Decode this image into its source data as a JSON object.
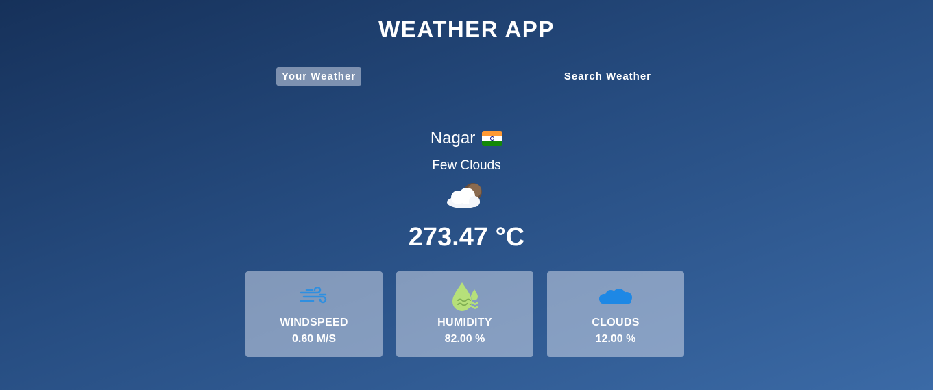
{
  "header": {
    "title": "WEATHER APP"
  },
  "tabs": [
    {
      "label": "Your Weather",
      "active": true
    },
    {
      "label": "Search Weather",
      "active": false
    }
  ],
  "weather": {
    "city": "Nagar",
    "country_flag_icon": "india-flag-icon",
    "description": "Few Clouds",
    "condition_icon": "few-clouds-icon",
    "temperature": "273.47 °C"
  },
  "stats": [
    {
      "label": "WINDSPEED",
      "value": "0.60 M/S",
      "icon": "wind-icon"
    },
    {
      "label": "HUMIDITY",
      "value": "82.00 %",
      "icon": "humidity-icon"
    },
    {
      "label": "CLOUDS",
      "value": "12.00 %",
      "icon": "cloud-icon"
    }
  ],
  "colors": {
    "background_top": "#16315a",
    "background_bottom": "#3b6aa6",
    "card_background": "rgba(219,226,239,0.5)",
    "wind_icon": "#2f8fe0",
    "humidity_icon": "#b6e07a",
    "cloud_icon": "#1e88e5"
  }
}
